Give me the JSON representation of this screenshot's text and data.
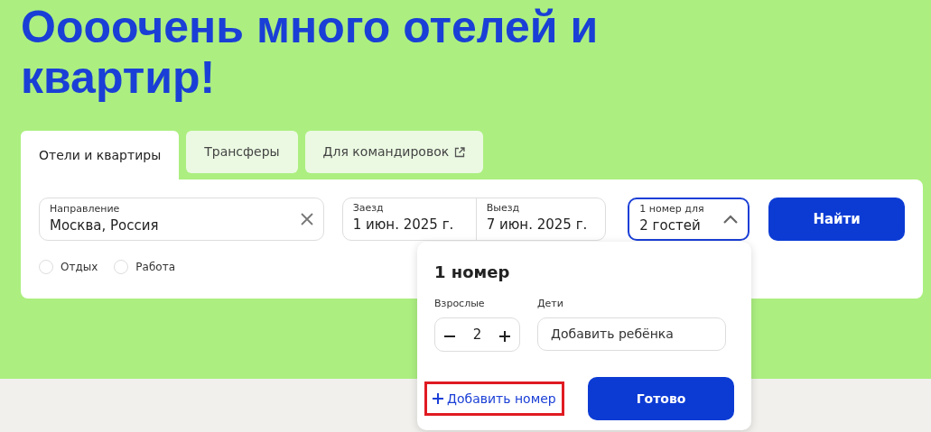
{
  "title": "Оооочень много отелей и квартир!",
  "tabs": [
    {
      "label": "Отели и квартиры",
      "selected": true,
      "external": false
    },
    {
      "label": "Трансферы",
      "selected": false,
      "external": false
    },
    {
      "label": "Для командировок",
      "selected": false,
      "external": true
    }
  ],
  "search": {
    "destination": {
      "label": "Направление",
      "value": "Москва, Россия"
    },
    "checkin": {
      "label": "Заезд",
      "value": "1 июн. 2025 г."
    },
    "checkout": {
      "label": "Выезд",
      "value": "7 июн. 2025 г."
    },
    "guests": {
      "label": "1 номер для",
      "value": "2 гостей",
      "expanded": true
    },
    "button": "Найти"
  },
  "trip_type": [
    {
      "label": "Отдых",
      "selected": false
    },
    {
      "label": "Работа",
      "selected": false
    }
  ],
  "guests_popup": {
    "title": "1 номер",
    "adults": {
      "label": "Взрослые",
      "value": "2"
    },
    "children": {
      "label": "Дети",
      "button": "Добавить ребёнка"
    },
    "add_room": {
      "label": "Добавить номер",
      "highlighted": true
    },
    "done": "Готово"
  }
}
